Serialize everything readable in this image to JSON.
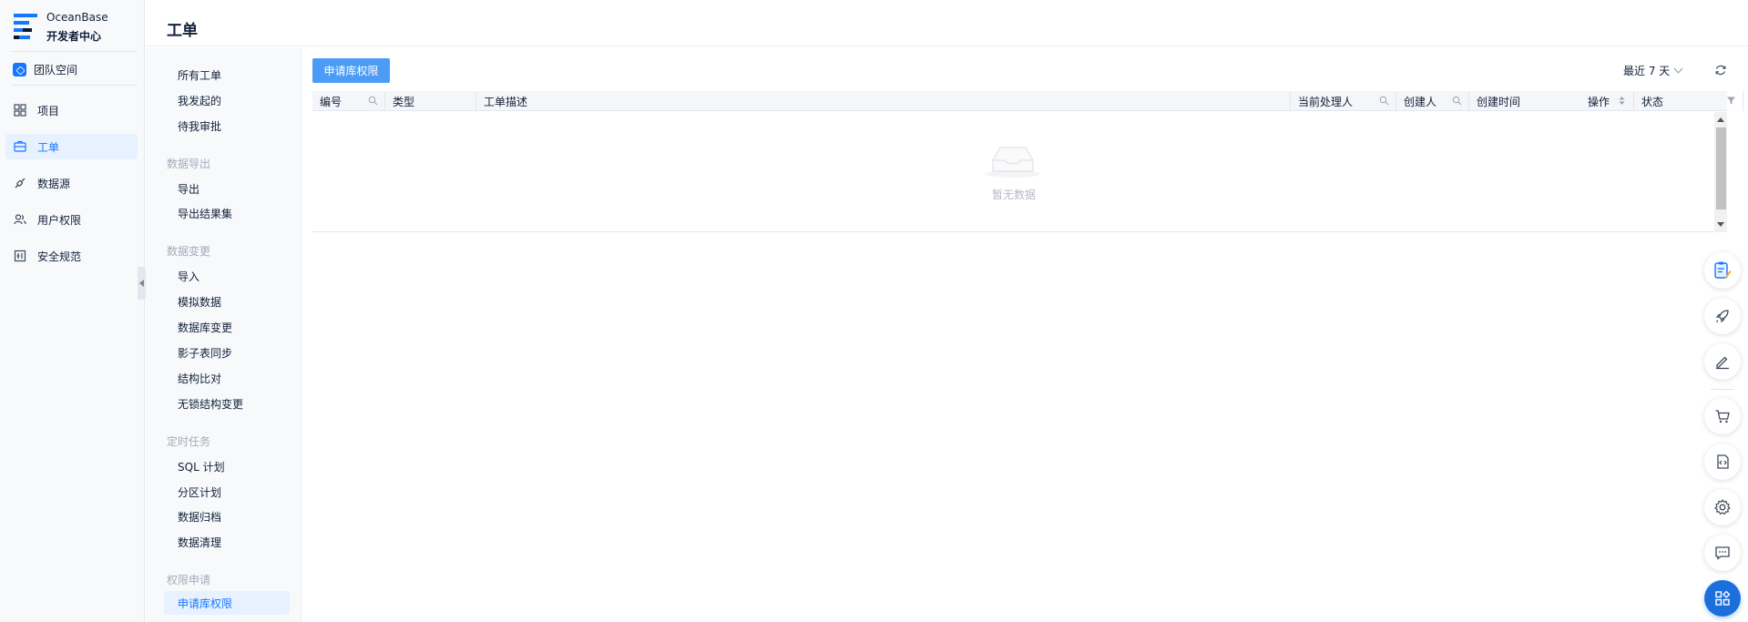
{
  "brand": {
    "line1": "OceanBase",
    "line2": "开发者中心"
  },
  "team": {
    "label": "团队空间"
  },
  "nav": [
    {
      "label": "项目",
      "icon": "grid-icon"
    },
    {
      "label": "工单",
      "icon": "ticket-icon",
      "active": true
    },
    {
      "label": "数据源",
      "icon": "link-icon"
    },
    {
      "label": "用户权限",
      "icon": "users-icon"
    },
    {
      "label": "安全规范",
      "icon": "shield-rule-icon"
    }
  ],
  "page": {
    "title": "工单"
  },
  "submenu": {
    "top": [
      "所有工单",
      "我发起的",
      "待我审批"
    ],
    "export_group": "数据导出",
    "export_items": [
      "导出",
      "导出结果集"
    ],
    "change_group": "数据变更",
    "change_items": [
      "导入",
      "模拟数据",
      "数据库变更",
      "影子表同步",
      "结构比对",
      "无锁结构变更"
    ],
    "schedule_group": "定时任务",
    "schedule_items": [
      "SQL 计划",
      "分区计划",
      "数据归档",
      "数据清理"
    ],
    "perm_group": "权限申请",
    "perm_items": [
      "申请库权限"
    ]
  },
  "toolbar": {
    "apply_button": "申请库权限",
    "range_label": "最近 7 天"
  },
  "table": {
    "columns": [
      "编号",
      "类型",
      "工单描述",
      "当前处理人",
      "创建人",
      "创建时间",
      "状态",
      "操作"
    ],
    "empty_text": "暂无数据"
  },
  "rail_icons": [
    "clipboard-edit-icon",
    "rocket-icon",
    "pen-icon",
    "cart-icon",
    "code-doc-icon",
    "gear-icon",
    "message-icon",
    "apps-icon"
  ],
  "colors": {
    "accent": "#1677ff",
    "button": "#4c9cf5",
    "rail_primary": "#1a6fdc"
  }
}
